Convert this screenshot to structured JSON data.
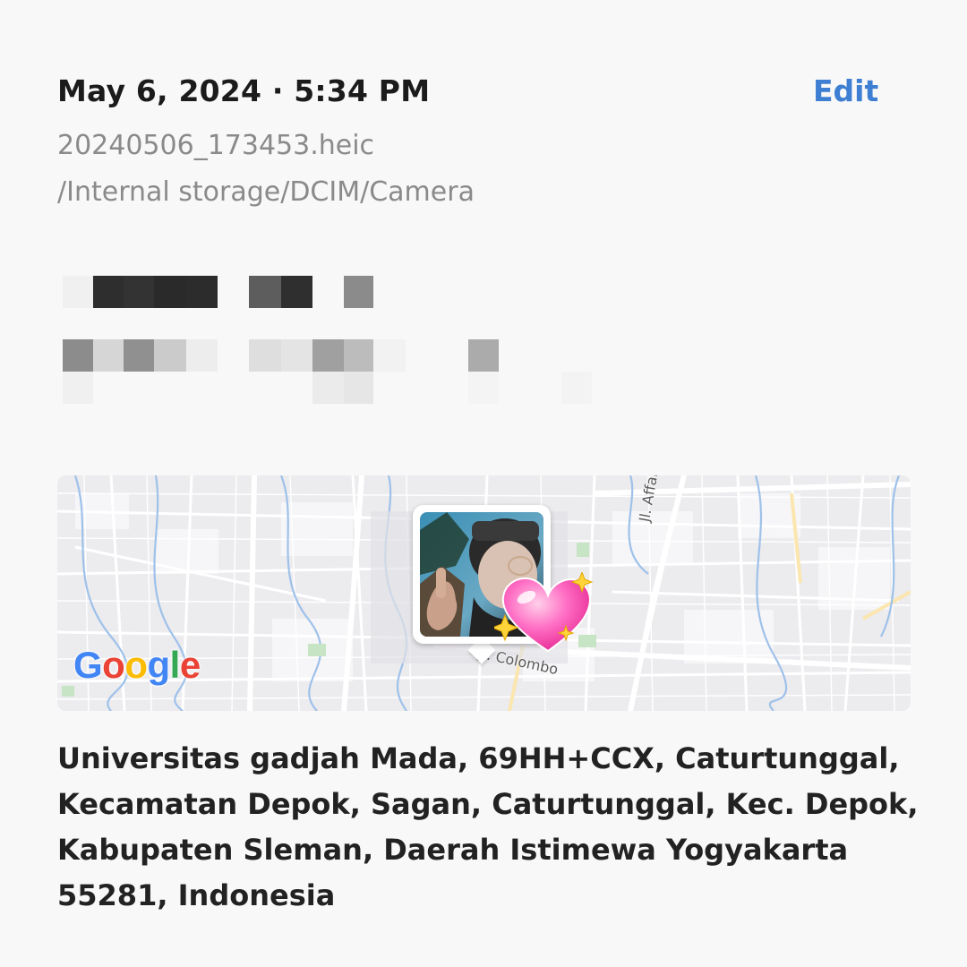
{
  "header": {
    "date_time": "May 6, 2024 · 5:34 PM",
    "edit_label": "Edit"
  },
  "file": {
    "name": "20240506_173453.heic",
    "path": "/Internal storage/DCIM/Camera"
  },
  "map": {
    "provider_logo": "Google",
    "streets": [
      "Jl. Colombo",
      "Jl. Affandi"
    ]
  },
  "location": {
    "address": "Universitas gadjah Mada, 69HH+CCX, Caturtunggal, Kecamatan Depok, Sagan, Caturtunggal, Kec. Depok, Kabupaten Sleman, Daerah Istimewa Yogyakarta 55281, Indonesia"
  },
  "colors": {
    "accent": "#3f7fd3",
    "secondary_text": "#8a8a8a",
    "primary_text": "#1b1b1b"
  },
  "icons": {
    "photo_pin": "photo-thumbnail-pin",
    "sticker": "sparkling-heart-icon"
  }
}
